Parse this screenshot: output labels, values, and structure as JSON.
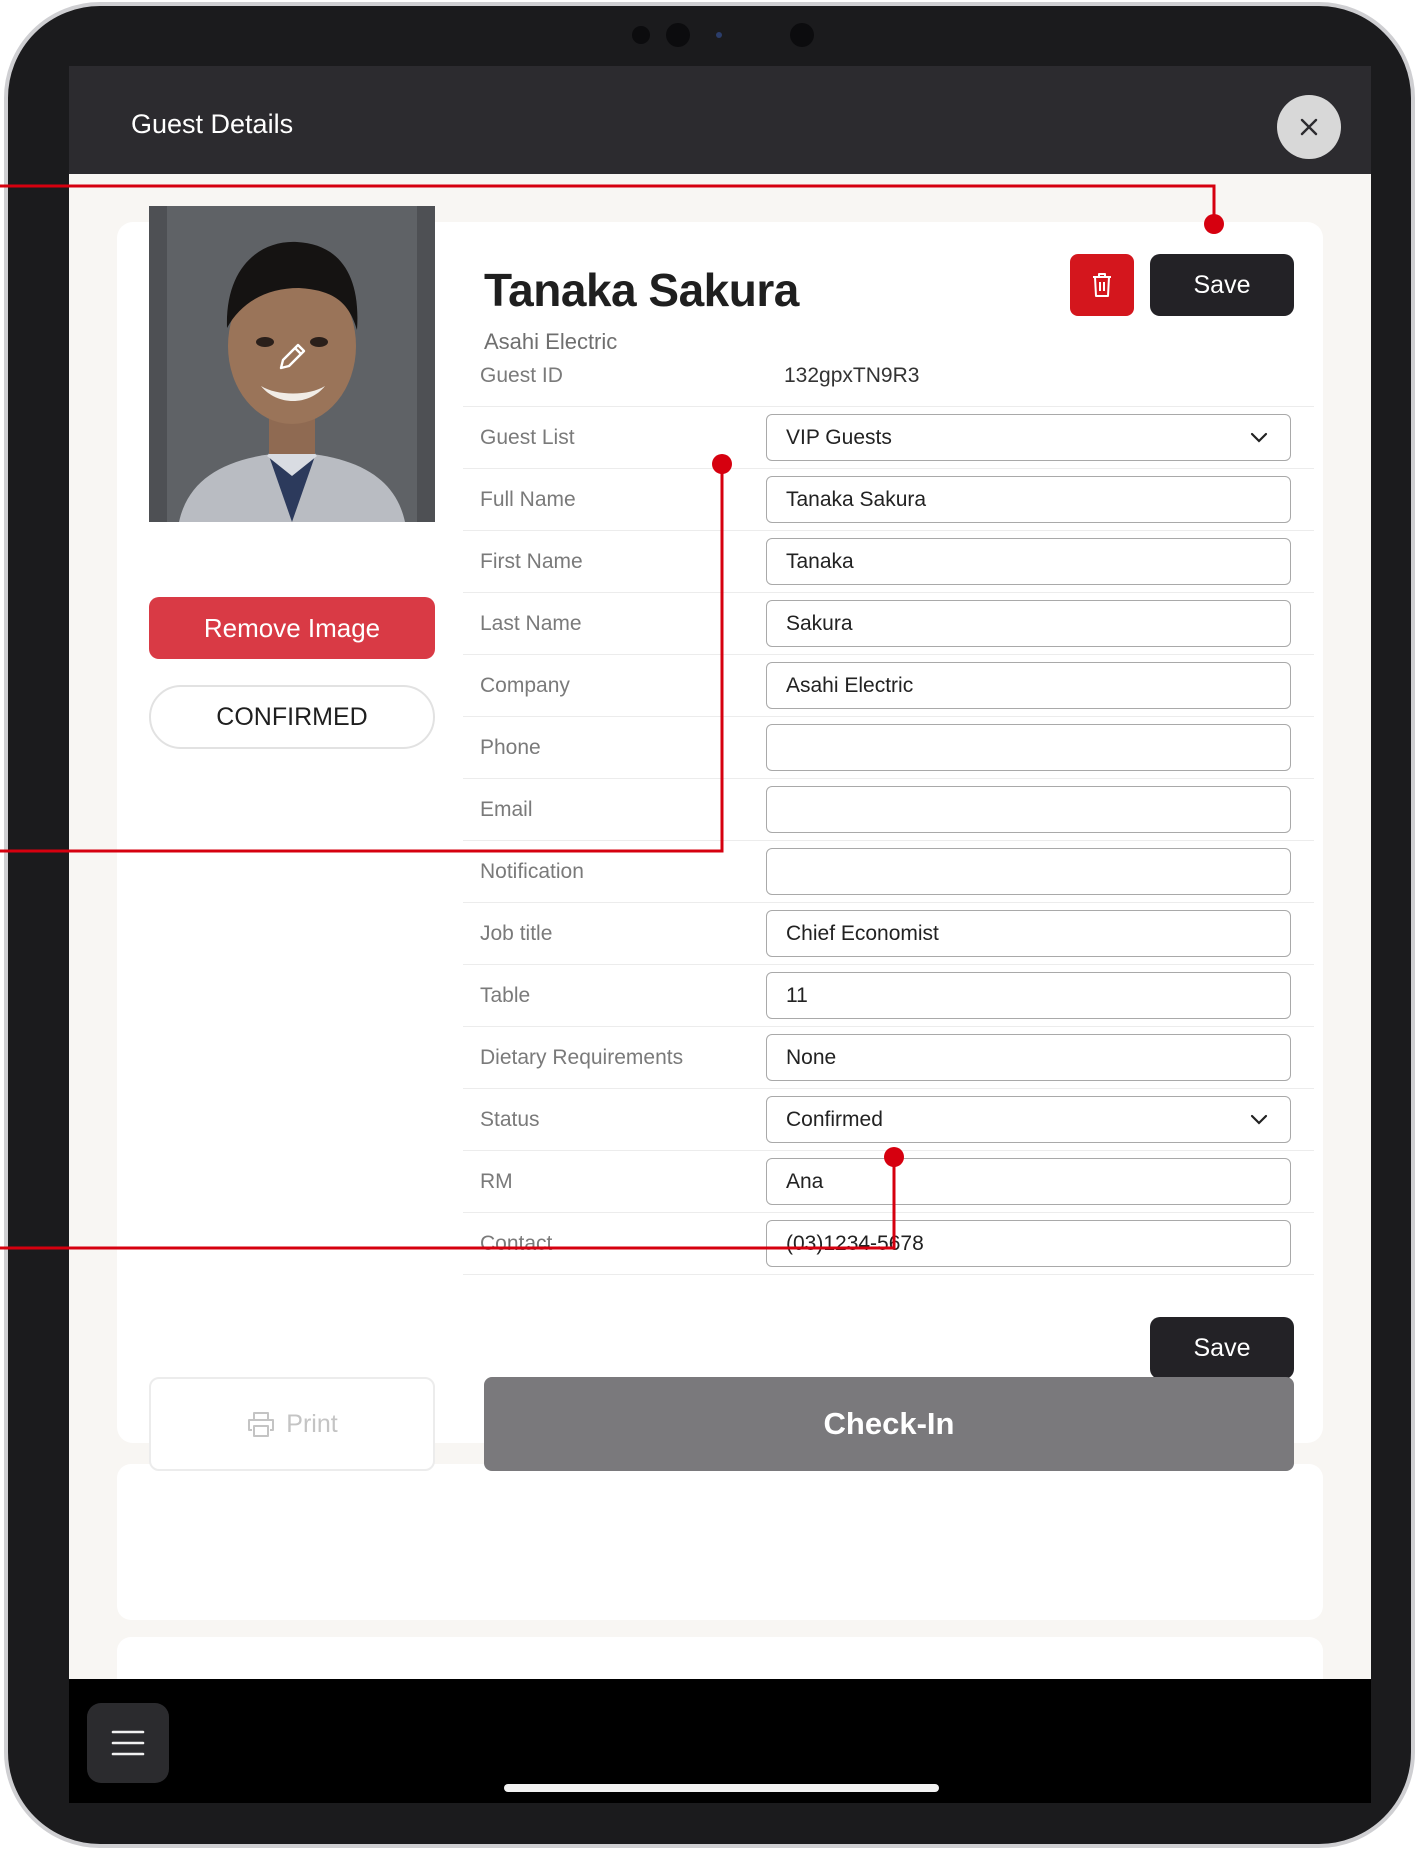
{
  "header": {
    "title": "Guest Details"
  },
  "profile": {
    "remove_image_label": "Remove Image",
    "status_badge": "CONFIRMED",
    "name": "Tanaka Sakura",
    "company": "Asahi Electric"
  },
  "actions": {
    "save_label": "Save",
    "print_label": "Print",
    "checkin_label": "Check-In"
  },
  "fields": {
    "guest_id": {
      "label": "Guest ID",
      "value": "132gpxTN9R3"
    },
    "guest_list": {
      "label": "Guest List",
      "value": "VIP Guests"
    },
    "full_name": {
      "label": "Full Name",
      "value": "Tanaka Sakura"
    },
    "first_name": {
      "label": "First Name",
      "value": "Tanaka"
    },
    "last_name": {
      "label": "Last Name",
      "value": "Sakura"
    },
    "company": {
      "label": "Company",
      "value": "Asahi Electric"
    },
    "phone": {
      "label": "Phone",
      "value": ""
    },
    "email": {
      "label": "Email",
      "value": ""
    },
    "notification": {
      "label": "Notification",
      "value": ""
    },
    "job_title": {
      "label": "Job title",
      "value": "Chief Economist"
    },
    "table": {
      "label": "Table",
      "value": "11"
    },
    "dietary": {
      "label": "Dietary Requirements",
      "value": "None"
    },
    "status": {
      "label": "Status",
      "value": "Confirmed"
    },
    "rm": {
      "label": "RM",
      "value": "Ana"
    },
    "contact": {
      "label": "Contact",
      "value": "(03)1234-5678"
    }
  },
  "icons": {
    "close": "close-icon",
    "trash": "trash-icon",
    "edit": "pencil-icon",
    "chevron": "chevron-down-icon",
    "print": "printer-icon",
    "menu": "hamburger-icon"
  },
  "colors": {
    "danger": "#d4161d",
    "remove": "#d93a45",
    "dark": "#232226",
    "callout": "#d6000f"
  }
}
